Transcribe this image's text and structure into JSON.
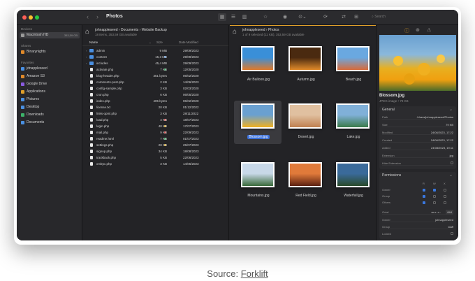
{
  "window": {
    "title": "Photos",
    "search_placeholder": "Search"
  },
  "sidebar": {
    "sections": [
      {
        "title": "Devices",
        "items": [
          {
            "label": "Macintosh HD",
            "extra": "353,59 GB",
            "icon": "drive-icon",
            "color": "#9a9a9a"
          }
        ]
      },
      {
        "title": "Shares",
        "items": [
          {
            "label": "Binarynights",
            "icon": "share-icon",
            "color": "#e08a2a"
          }
        ]
      },
      {
        "title": "Favorites",
        "items": [
          {
            "label": "jdnappleseed",
            "icon": "folder-icon",
            "color": "#4a90e2"
          },
          {
            "label": "Amazon S3",
            "icon": "cloud-icon",
            "color": "#e08a2a"
          },
          {
            "label": "Google Drive",
            "icon": "drive-cloud-icon",
            "color": "#8a5be0"
          },
          {
            "label": "Applications",
            "icon": "apps-icon",
            "color": "#e0a02a"
          },
          {
            "label": "Pictures",
            "icon": "pictures-icon",
            "color": "#4a90e2"
          },
          {
            "label": "Desktop",
            "icon": "desktop-icon",
            "color": "#4a90e2"
          },
          {
            "label": "Downloads",
            "icon": "downloads-icon",
            "color": "#3db36a"
          },
          {
            "label": "Documents",
            "icon": "documents-icon",
            "color": "#4a90e2"
          }
        ]
      }
    ]
  },
  "left_pane": {
    "path": "johnappleseed › Documents › Website Backup",
    "subtitle": "18 items, 353,59 GB available",
    "columns": {
      "name": "Name",
      "size": "Size",
      "date": "Date Modified"
    },
    "rows": [
      {
        "name": "admin",
        "folder": true,
        "size": "9 MB",
        "date": "29/09/2023",
        "tag": ""
      },
      {
        "name": "content",
        "folder": true,
        "size": "15,3 MB",
        "date": "29/09/2023",
        "tag": "#4a90e2"
      },
      {
        "name": "includes",
        "folder": true,
        "size": "45,4 MB",
        "date": "29/09/2023",
        "tag": ""
      },
      {
        "name": "activate.php",
        "folder": false,
        "size": "7 KB",
        "date": "12/05/2020",
        "tag": "#3db36a"
      },
      {
        "name": "blog-header.php",
        "folder": false,
        "size": "351 bytes",
        "date": "06/02/2020",
        "tag": ""
      },
      {
        "name": "comments-post.php",
        "folder": false,
        "size": "2 KB",
        "date": "14/06/2023",
        "tag": ""
      },
      {
        "name": "config-sample.php",
        "folder": false,
        "size": "3 KB",
        "date": "02/03/2020",
        "tag": ""
      },
      {
        "name": "cron.php",
        "folder": false,
        "size": "6 KB",
        "date": "06/05/2020",
        "tag": ""
      },
      {
        "name": "index.php",
        "folder": false,
        "size": "405 bytes",
        "date": "06/02/2020",
        "tag": ""
      },
      {
        "name": "license.txt",
        "folder": false,
        "size": "20 KB",
        "date": "01/12/2022",
        "tag": ""
      },
      {
        "name": "links-opml.php",
        "folder": false,
        "size": "3 KB",
        "date": "28/11/2022",
        "tag": ""
      },
      {
        "name": "load.php",
        "folder": false,
        "size": "4 KB",
        "date": "18/07/2023",
        "tag": "#e05050"
      },
      {
        "name": "login.php",
        "folder": false,
        "size": "48 KB",
        "date": "17/07/2023",
        "tag": "#e0b02a"
      },
      {
        "name": "mail.php",
        "folder": false,
        "size": "9 KB",
        "date": "22/09/2023",
        "tag": "#e05050"
      },
      {
        "name": "readme.html",
        "folder": false,
        "size": "7 KB",
        "date": "01/07/2023",
        "tag": "#3db36a"
      },
      {
        "name": "settings.php",
        "folder": false,
        "size": "28 KB",
        "date": "25/07/2023",
        "tag": "#e0b02a"
      },
      {
        "name": "signup.php",
        "folder": false,
        "size": "34 KB",
        "date": "18/08/2023",
        "tag": ""
      },
      {
        "name": "trackback.php",
        "folder": false,
        "size": "5 KB",
        "date": "22/06/2023",
        "tag": ""
      },
      {
        "name": "xmlrpc.php",
        "folder": false,
        "size": "3 KB",
        "date": "14/06/2023",
        "tag": ""
      }
    ]
  },
  "right_pane": {
    "path": "johnappleseed › Photos",
    "subtitle": "1 of 9 selected (11 KB), 353,59 GB available",
    "photos": [
      {
        "label": "Air Balloon.jpg",
        "colors": [
          "#3a8fd8",
          "#e07a2a"
        ],
        "selected": false
      },
      {
        "label": "Autumn.jpg",
        "colors": [
          "#4a2a10",
          "#e08a2a"
        ],
        "selected": false
      },
      {
        "label": "Beach.jpg",
        "colors": [
          "#6aa8e0",
          "#d86a3a"
        ],
        "selected": false
      },
      {
        "label": "Blossom.jpg",
        "colors": [
          "#6aa0d0",
          "#f0b020"
        ],
        "selected": true
      },
      {
        "label": "Desert.jpg",
        "colors": [
          "#e0c0a0",
          "#c08050"
        ],
        "selected": false
      },
      {
        "label": "Lake.jpg",
        "colors": [
          "#80b0d8",
          "#3a7a4a"
        ],
        "selected": false
      },
      {
        "label": "Mountains.jpg",
        "colors": [
          "#c8d8e8",
          "#3a6a3a"
        ],
        "selected": false
      },
      {
        "label": "Red Field.jpg",
        "colors": [
          "#e07a3a",
          "#5a2010"
        ],
        "selected": false
      },
      {
        "label": "Waterfall.jpg",
        "colors": [
          "#3a6a9a",
          "#2a4a2a"
        ],
        "selected": false
      }
    ]
  },
  "inspector": {
    "file_name": "Blossom.jpg",
    "file_kind": "JPEG image • 79 KB",
    "general": {
      "title": "General",
      "rows": [
        {
          "label": "Path",
          "value": "/Users/johnappleseed/Photos"
        },
        {
          "label": "Size",
          "value": "79 KB"
        },
        {
          "label": "Modified",
          "value": "24/08/2023, 17:22"
        },
        {
          "label": "Created",
          "value": "24/08/2023, 17:22"
        },
        {
          "label": "Added",
          "value": "24/08/2023, 19:11"
        },
        {
          "label": "Extension",
          "value": "jpg"
        },
        {
          "label": "Hide Extension",
          "value": ""
        }
      ]
    },
    "permissions": {
      "title": "Permissions",
      "headers": [
        "R",
        "W",
        "X"
      ],
      "rows": [
        {
          "label": "Owner",
          "checks": [
            true,
            true,
            false
          ]
        },
        {
          "label": "Group",
          "checks": [
            true,
            false,
            false
          ]
        },
        {
          "label": "Others",
          "checks": [
            true,
            false,
            false
          ]
        }
      ],
      "octal_label": "Octal",
      "octal_symbolic": "rw-r--r--",
      "octal_value": "644",
      "owner_label": "Owner",
      "owner_value": "johnappleseed",
      "group_label": "Group",
      "group_value": "staff",
      "locked_label": "Locked"
    }
  },
  "caption": {
    "prefix": "Source: ",
    "link": "Forklift"
  }
}
